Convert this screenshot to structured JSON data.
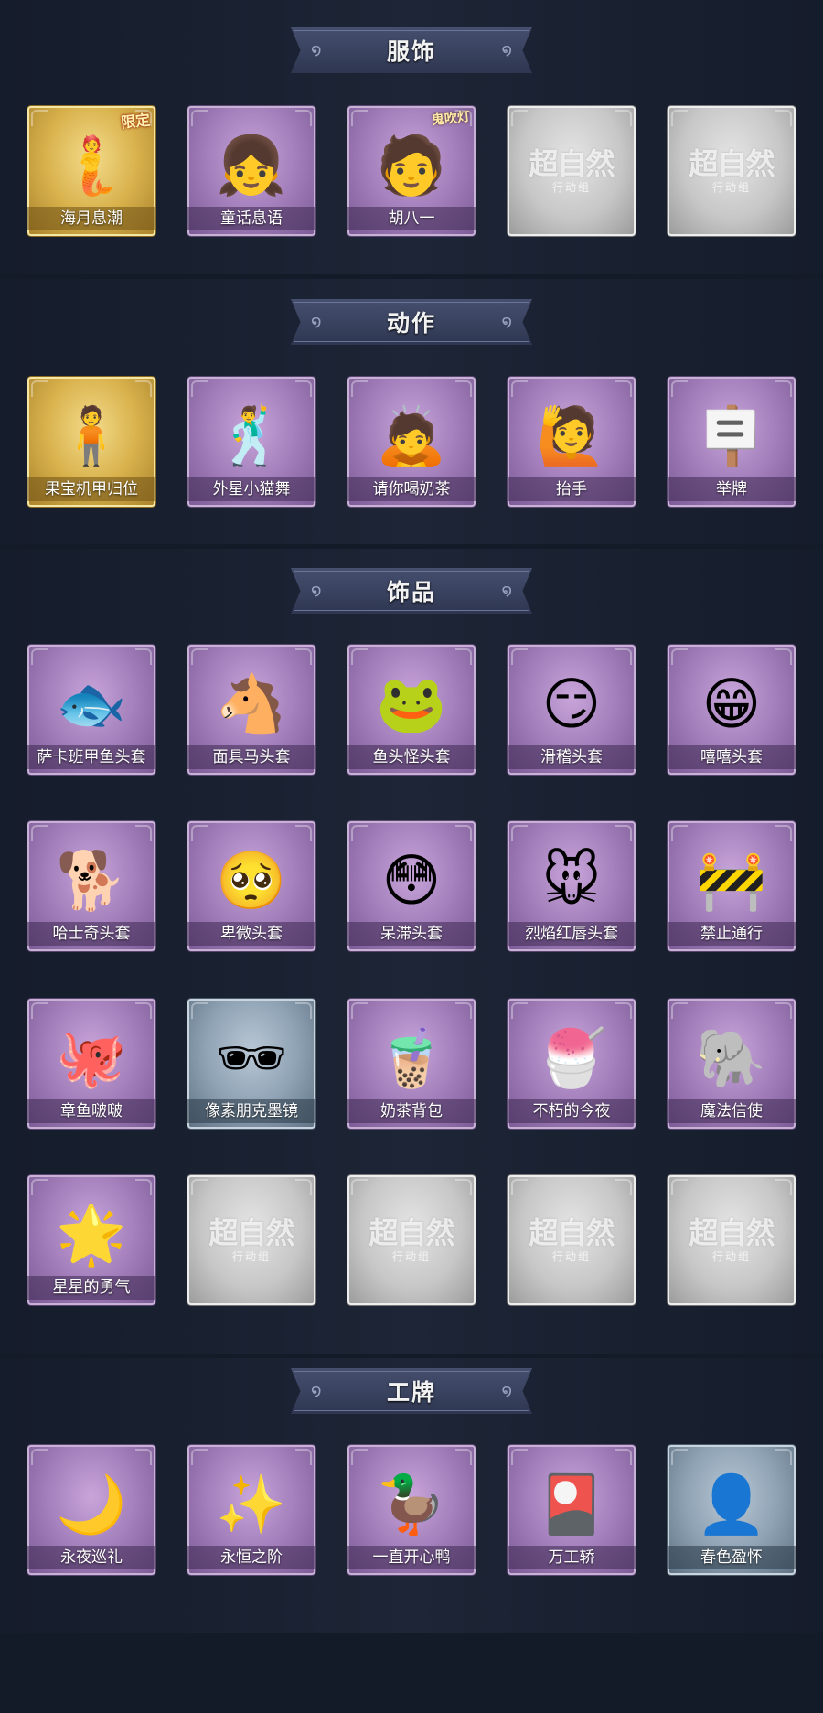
{
  "sections": {
    "clothing": {
      "title": "服饰",
      "items": [
        {
          "label": "海月息潮",
          "badge": "限定",
          "icon": "mermaid-portrait-icon",
          "style": "gold"
        },
        {
          "label": "童话息语",
          "icon": "girl-portrait-icon",
          "style": "purple"
        },
        {
          "label": "胡八一",
          "badge": "鬼吹灯",
          "icon": "boy-portrait-icon",
          "style": "purple"
        },
        {
          "watermark": "超自然",
          "watermark_sub": "行动组",
          "icon": "locked-slot-icon",
          "style": "gray"
        },
        {
          "watermark": "超自然",
          "watermark_sub": "行动组",
          "icon": "locked-slot-icon",
          "style": "gray"
        }
      ]
    },
    "actions": {
      "title": "动作",
      "items": [
        {
          "label": "果宝机甲归位",
          "icon": "pose-figure-icon",
          "style": "gold"
        },
        {
          "label": "外星小猫舞",
          "icon": "dance-figure-icon",
          "style": "purple"
        },
        {
          "label": "请你喝奶茶",
          "icon": "offer-figure-icon",
          "style": "purple"
        },
        {
          "label": "抬手",
          "icon": "raise-hand-figure-icon",
          "style": "purple"
        },
        {
          "label": "举牌",
          "icon": "hold-sign-figure-icon",
          "style": "purple"
        }
      ]
    },
    "accessories": {
      "title": "饰品",
      "rows": [
        [
          {
            "label": "萨卡班甲鱼头套",
            "icon": "fish-head-icon",
            "style": "purple"
          },
          {
            "label": "面具马头套",
            "icon": "horse-head-icon",
            "style": "purple"
          },
          {
            "label": "鱼头怪头套",
            "icon": "fish-monster-head-icon",
            "style": "purple"
          },
          {
            "label": "滑稽头套",
            "icon": "funny-face-icon",
            "style": "purple"
          },
          {
            "label": "嘻嘻头套",
            "icon": "grin-face-icon",
            "style": "purple"
          }
        ],
        [
          {
            "label": "哈士奇头套",
            "icon": "husky-head-icon",
            "style": "purple"
          },
          {
            "label": "卑微头套",
            "icon": "humble-face-icon",
            "style": "purple"
          },
          {
            "label": "呆滞头套",
            "icon": "dazed-face-icon",
            "style": "purple"
          },
          {
            "label": "烈焰红唇头套",
            "icon": "pikachu-head-icon",
            "style": "purple"
          },
          {
            "label": "禁止通行",
            "icon": "traffic-cone-icon",
            "style": "purple"
          }
        ],
        [
          {
            "label": "章鱼啵啵",
            "icon": "octopus-icon",
            "style": "purple"
          },
          {
            "label": "像素朋克墨镜",
            "icon": "pixel-sunglasses-icon",
            "style": "blue"
          },
          {
            "label": "奶茶背包",
            "icon": "milk-tea-backpack-icon",
            "style": "purple"
          },
          {
            "label": "不朽的今夜",
            "icon": "dessert-cat-icon",
            "style": "purple"
          },
          {
            "label": "魔法信使",
            "icon": "elephant-icon",
            "style": "purple"
          }
        ],
        [
          {
            "label": "星星的勇气",
            "icon": "star-charm-icon",
            "style": "purple"
          },
          {
            "watermark": "超自然",
            "watermark_sub": "行动组",
            "icon": "locked-slot-icon",
            "style": "gray"
          },
          {
            "watermark": "超自然",
            "watermark_sub": "行动组",
            "icon": "locked-slot-icon",
            "style": "gray"
          },
          {
            "watermark": "超自然",
            "watermark_sub": "行动组",
            "icon": "locked-slot-icon",
            "style": "gray"
          },
          {
            "watermark": "超自然",
            "watermark_sub": "行动组",
            "icon": "locked-slot-icon",
            "style": "gray"
          }
        ]
      ]
    },
    "badges": {
      "title": "工牌",
      "items": [
        {
          "label": "永夜巡礼",
          "icon": "night-card-icon",
          "style": "purple"
        },
        {
          "label": "永恒之阶",
          "icon": "light-card-icon",
          "style": "purple"
        },
        {
          "label": "一直开心鸭",
          "icon": "duck-card-icon",
          "style": "purple"
        },
        {
          "label": "万工轿",
          "icon": "sedan-card-icon",
          "style": "purple"
        },
        {
          "label": "春色盈怀",
          "icon": "silhouette-card-icon",
          "style": "blue"
        }
      ]
    }
  },
  "glyphs": {
    "mermaid-portrait-icon": "🧜",
    "girl-portrait-icon": "👧",
    "boy-portrait-icon": "🧑",
    "locked-slot-icon": "",
    "pose-figure-icon": "🧍",
    "dance-figure-icon": "🕺",
    "offer-figure-icon": "🙇",
    "raise-hand-figure-icon": "🙋",
    "hold-sign-figure-icon": "🪧",
    "fish-head-icon": "🐟",
    "horse-head-icon": "🐴",
    "fish-monster-head-icon": "🐸",
    "funny-face-icon": "😏",
    "grin-face-icon": "😁",
    "husky-head-icon": "🐕",
    "humble-face-icon": "🥺",
    "dazed-face-icon": "😳",
    "pikachu-head-icon": "🐭",
    "traffic-cone-icon": "🚧",
    "octopus-icon": "🐙",
    "pixel-sunglasses-icon": "🕶",
    "milk-tea-backpack-icon": "🧋",
    "dessert-cat-icon": "🍧",
    "elephant-icon": "🐘",
    "star-charm-icon": "🌟",
    "night-card-icon": "🌙",
    "light-card-icon": "✨",
    "duck-card-icon": "🦆",
    "sedan-card-icon": "🎴",
    "silhouette-card-icon": "👤"
  }
}
